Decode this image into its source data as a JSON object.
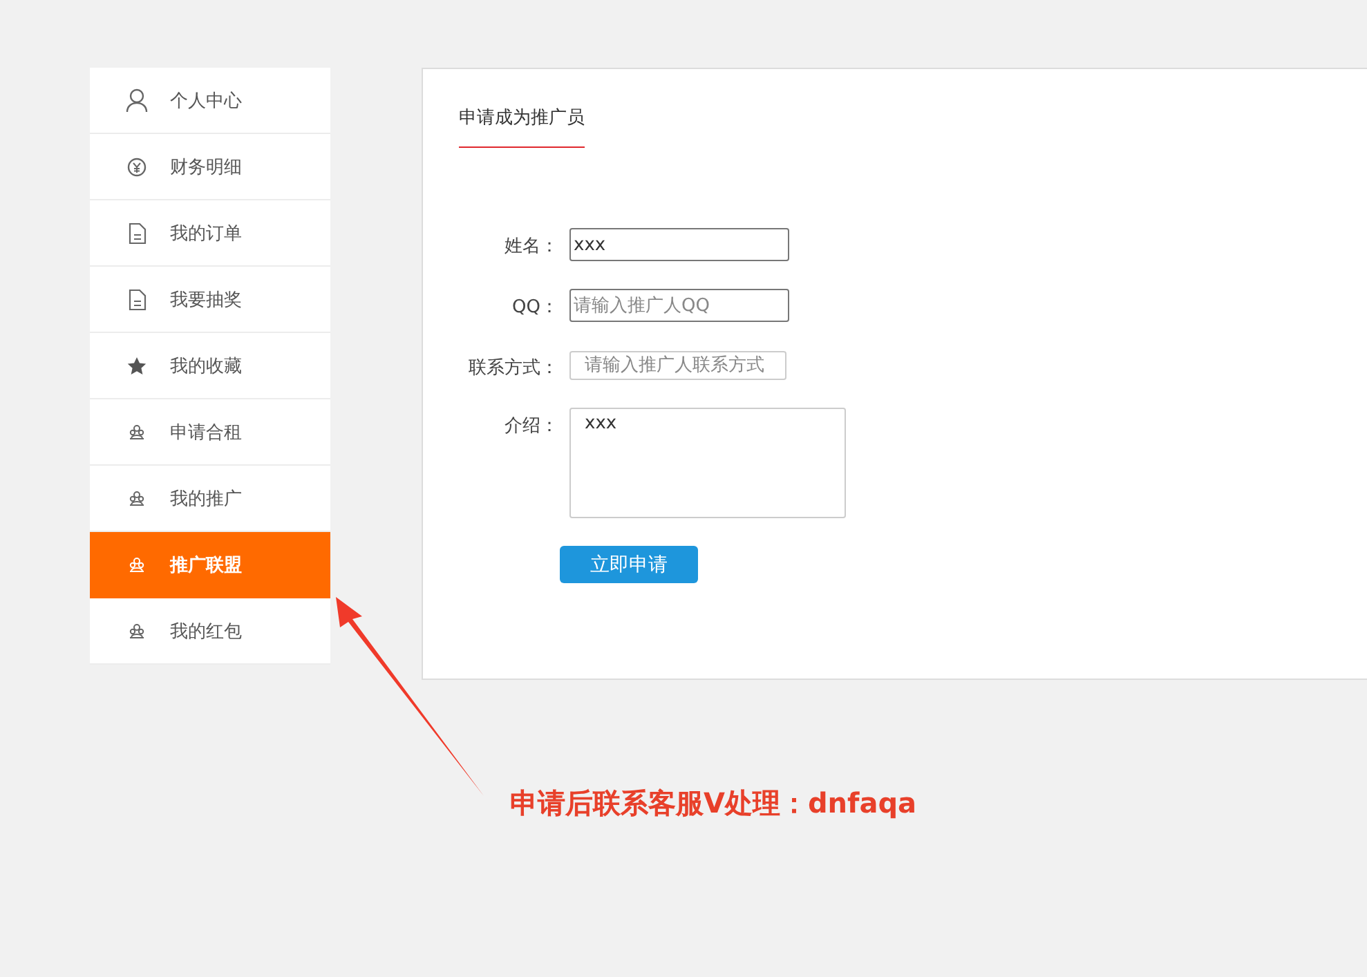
{
  "sidebar": {
    "items": [
      {
        "label": "个人中心",
        "kind": "user",
        "selected": false
      },
      {
        "label": "财务明细",
        "kind": "yen",
        "selected": false
      },
      {
        "label": "我的订单",
        "kind": "document",
        "selected": false
      },
      {
        "label": "我要抽奖",
        "kind": "document",
        "selected": false
      },
      {
        "label": "我的收藏",
        "kind": "star",
        "selected": false
      },
      {
        "label": "申请合租",
        "kind": "group",
        "selected": false
      },
      {
        "label": "我的推广",
        "kind": "group",
        "selected": false
      },
      {
        "label": "推广联盟",
        "kind": "group",
        "selected": true
      },
      {
        "label": "我的红包",
        "kind": "group",
        "selected": false
      }
    ]
  },
  "panel": {
    "tabs": [
      {
        "label": "申请成为推广员",
        "selected": true
      }
    ],
    "fields": [
      {
        "kind": "input",
        "label": "姓名：",
        "value": "xxx"
      },
      {
        "kind": "input",
        "label": "QQ：",
        "placeholder": "请输入推广人QQ"
      },
      {
        "kind": "light",
        "label": "联系方式：",
        "placeholder": "请输入推广人联系方式"
      },
      {
        "kind": "textarea",
        "label": "介绍：",
        "value": "xxx"
      }
    ],
    "submit": "立即申请"
  },
  "annotation": {
    "text": "申请后联系客服V处理：dnfaqa"
  }
}
